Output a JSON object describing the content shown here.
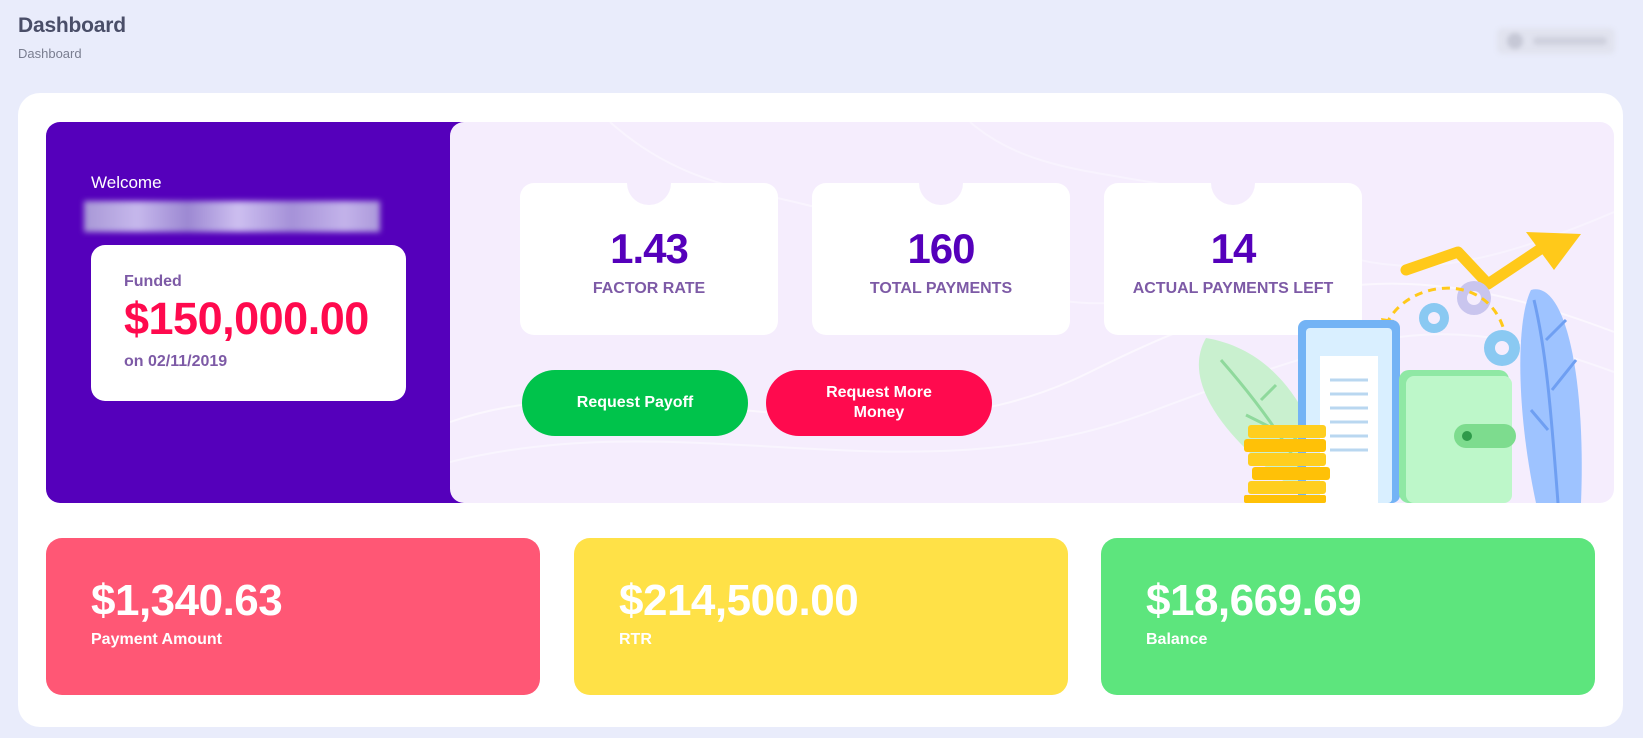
{
  "header": {
    "title": "Dashboard",
    "breadcrumb": "Dashboard"
  },
  "welcome": {
    "greeting": "Welcome"
  },
  "funded": {
    "label": "Funded",
    "amount": "$150,000.00",
    "date": "on 02/11/2019"
  },
  "stats": [
    {
      "value": "1.43",
      "label": "FACTOR RATE"
    },
    {
      "value": "160",
      "label": "TOTAL PAYMENTS"
    },
    {
      "value": "14",
      "label": "ACTUAL PAYMENTS LEFT"
    }
  ],
  "actions": {
    "payoff_label": "Request Payoff",
    "more_money_label": "Request More Money"
  },
  "summary": [
    {
      "value": "$1,340.63",
      "label": "Payment Amount"
    },
    {
      "value": "$214,500.00",
      "label": "RTR"
    },
    {
      "value": "$18,669.69",
      "label": "Balance"
    }
  ],
  "colors": {
    "background": "#e9ecfb",
    "purple": "#5500bb",
    "hero_light": "#f5edfd",
    "red": "#ff0a4e",
    "green_button": "#00c34b",
    "payment_card": "#ff5775",
    "rtr_card": "#ffe147",
    "balance_card": "#5de57d",
    "label_purple": "#7d5aa6"
  },
  "icons": {
    "illustration": "wallet-coins-growth-illustration"
  }
}
